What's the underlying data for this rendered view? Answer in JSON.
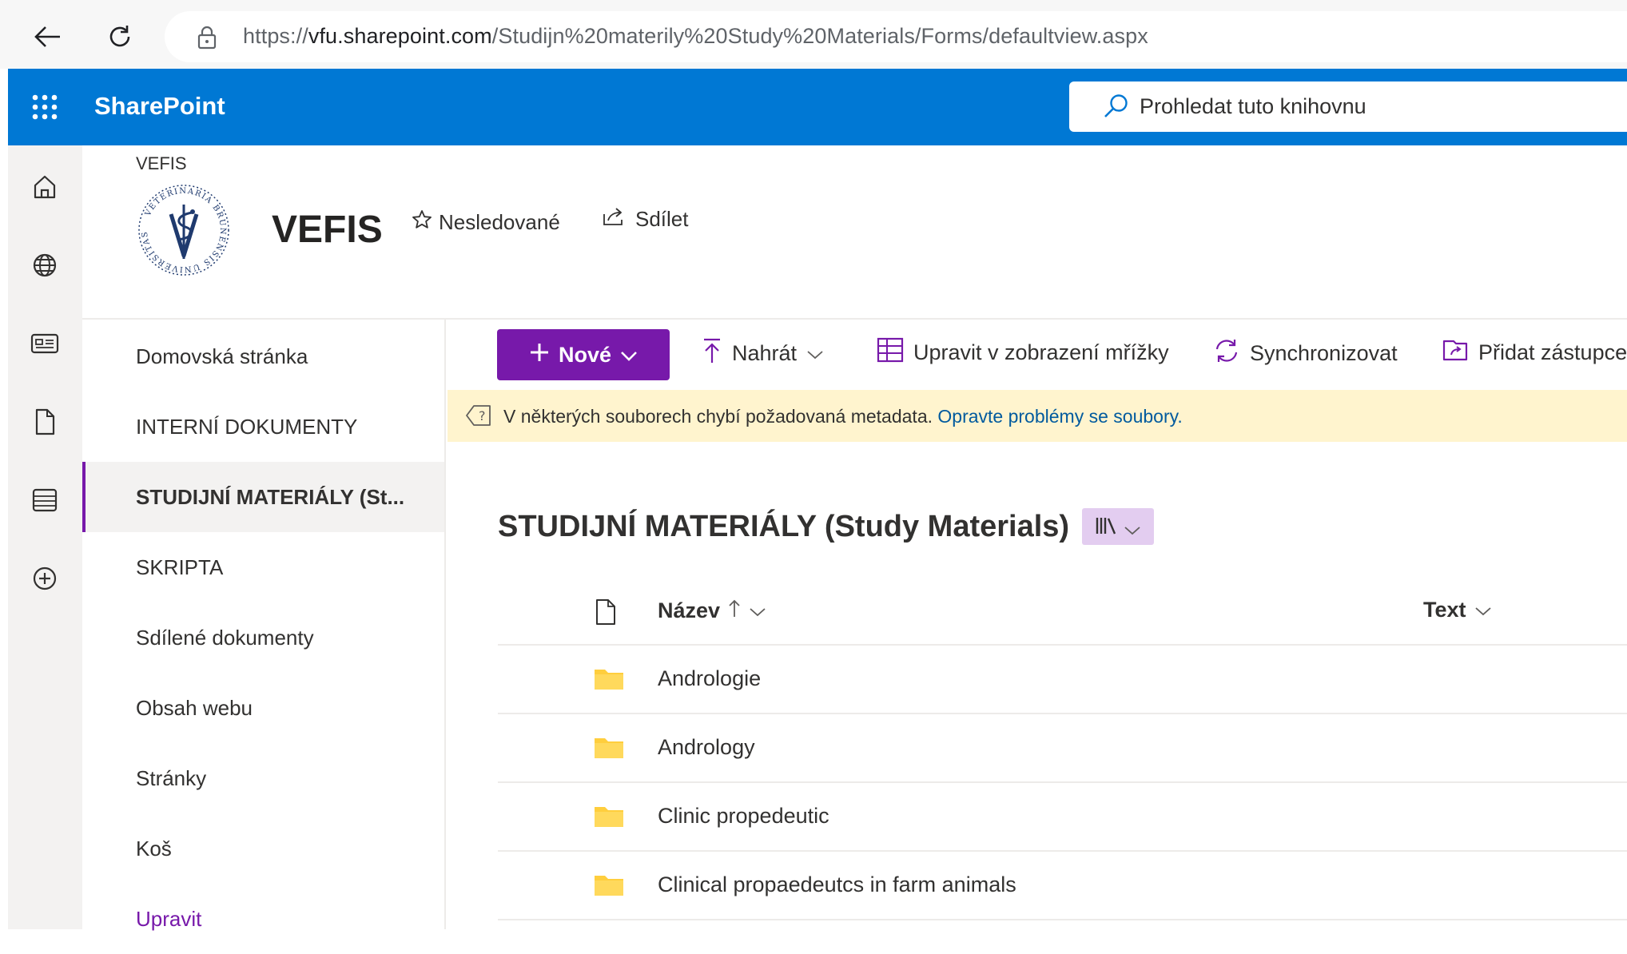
{
  "browser": {
    "url_prefix": "https://",
    "url_host": "vfu.sharepoint.com",
    "url_path": "/Studijn%20materily%20Study%20Materials/Forms/defaultview.aspx"
  },
  "suite": {
    "brand": "SharePoint",
    "search_placeholder": "Prohledat tuto knihovnu"
  },
  "site": {
    "label": "VEFIS",
    "title": "VEFIS",
    "follow_label": "Nesledované",
    "share_label": "Sdílet",
    "logo_lettering": "VETERINARIA BRUNENSIS UNIVERSITAS"
  },
  "leftnav": {
    "items": [
      {
        "label": "Domovská stránka"
      },
      {
        "label": "INTERNÍ DOKUMENTY"
      },
      {
        "label": "STUDIJNÍ MATERIÁLY (St..."
      },
      {
        "label": "SKRIPTA"
      },
      {
        "label": "Sdílené dokumenty"
      },
      {
        "label": "Obsah webu"
      },
      {
        "label": "Stránky"
      },
      {
        "label": "Koš"
      },
      {
        "label": "Upravit"
      }
    ],
    "selected_index": 2
  },
  "commandbar": {
    "new_label": "Nové",
    "upload_label": "Nahrát",
    "grid_label": "Upravit v zobrazení mřížky",
    "sync_label": "Synchronizovat",
    "shortcut_label": "Přidat zástupce"
  },
  "banner": {
    "message": "V některých souborech chybí požadovaná metadata.",
    "link": "Opravte problémy se soubory."
  },
  "library": {
    "title": "STUDIJNÍ MATERIÁLY (Study Materials)",
    "columns": {
      "name": "Název",
      "text": "Text"
    },
    "rows": [
      {
        "name": "Andrologie"
      },
      {
        "name": "Andrology"
      },
      {
        "name": "Clinic propedeutic"
      },
      {
        "name": "Clinical propaedeutcs in farm animals"
      }
    ]
  },
  "colors": {
    "suite_blue": "#0078d4",
    "accent_purple": "#7719aa",
    "banner_yellow": "#fff4ce",
    "folder_yellow": "#ffce3d"
  },
  "icons": [
    "back-arrow-icon",
    "refresh-icon",
    "lock-icon",
    "waffle-icon",
    "search-icon",
    "home-icon",
    "globe-icon",
    "news-icon",
    "file-icon",
    "list-icon",
    "add-circle-icon",
    "star-icon",
    "share-icon",
    "plus-icon",
    "chevron-down-icon",
    "upload-icon",
    "grid-icon",
    "sync-icon",
    "shortcut-icon",
    "warning-tag-icon",
    "library-view-icon",
    "document-icon",
    "sort-up-arrow-icon",
    "folder-icon"
  ]
}
